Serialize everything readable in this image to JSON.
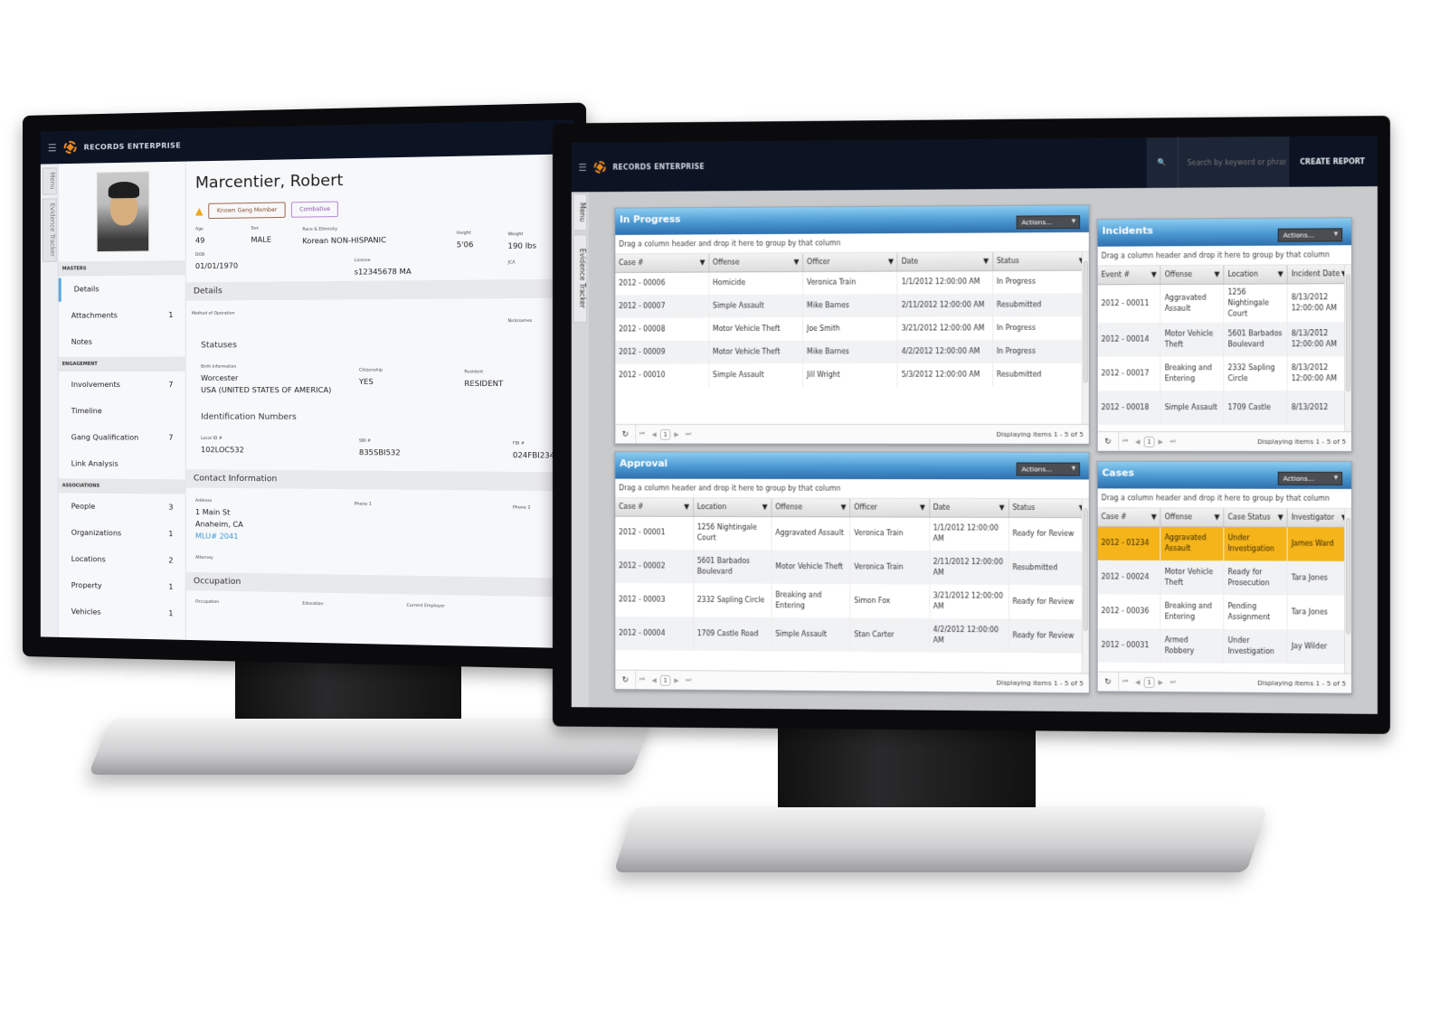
{
  "app": {
    "brand": "RECORDS ENTERPRISE",
    "menu_icon": "hamburger-icon",
    "logo_icon": "records-logo-icon"
  },
  "left_screen": {
    "side_tabs": [
      "Menu",
      "Evidence Tracker"
    ],
    "person": {
      "name": "Marcentier, Robert",
      "warning_icon": "warning-triangle-icon",
      "flags": [
        "Known Gang Member",
        "Combative"
      ],
      "summary": {
        "age": {
          "label": "Age",
          "value": "49"
        },
        "sex": {
          "label": "Sex",
          "value": "MALE"
        },
        "race": {
          "label": "Race & Ethnicity",
          "value": "Korean NON-HISPANIC"
        },
        "height": {
          "label": "Height",
          "value": "5'06"
        },
        "weight": {
          "label": "Weight",
          "value": "190 lbs"
        },
        "dob": {
          "label": "DOB",
          "value": "01/01/1970"
        },
        "license": {
          "label": "License",
          "value": "s12345678  MA"
        },
        "jca": {
          "label": "JCA",
          "value": ""
        }
      }
    },
    "nav": {
      "sections": [
        {
          "title": "MASTERS",
          "items": [
            {
              "label": "Details",
              "count": "",
              "active": true
            },
            {
              "label": "Attachments",
              "count": "1"
            },
            {
              "label": "Notes",
              "count": ""
            }
          ]
        },
        {
          "title": "ENGAGEMENT",
          "items": [
            {
              "label": "Involvements",
              "count": "7"
            },
            {
              "label": "Timeline",
              "count": ""
            },
            {
              "label": "Gang Qualification",
              "count": "7"
            },
            {
              "label": "Link Analysis",
              "count": ""
            }
          ]
        },
        {
          "title": "ASSOCIATIONS",
          "items": [
            {
              "label": "People",
              "count": "3"
            },
            {
              "label": "Organizations",
              "count": "1"
            },
            {
              "label": "Locations",
              "count": "2"
            },
            {
              "label": "Property",
              "count": "1"
            },
            {
              "label": "Vehicles",
              "count": "1"
            }
          ]
        }
      ]
    },
    "details": {
      "title": "Details",
      "method_label": "Method of Operation",
      "nicknames_label": "Nicknames",
      "statuses_title": "Statuses",
      "birth": {
        "label": "Birth Information",
        "line1": "Worcester",
        "line2": "USA (UNITED STATES OF AMERICA)"
      },
      "citizenship": {
        "label": "Citizenship",
        "value": "YES"
      },
      "resident": {
        "label": "Resident",
        "value": "RESIDENT"
      },
      "ids_title": "Identification Numbers",
      "local_id": {
        "label": "Local ID #",
        "value": "102LOC532"
      },
      "sbi": {
        "label": "SBI #",
        "value": "835SBI532"
      },
      "fbi": {
        "label": "FBI #",
        "value": "024FBI234"
      }
    },
    "contact": {
      "title": "Contact Information",
      "address_label": "Address",
      "address_line1": "1 Main St",
      "address_line2": "Anaheim, CA",
      "address_link": "MLU# 2041",
      "phone1_label": "Phone 1",
      "phone2_label": "Phone 2",
      "attorney_label": "Attorney"
    },
    "occupation": {
      "title": "Occupation",
      "occupation_label": "Occupation",
      "education_label": "Education",
      "employer_label": "Current Employer"
    }
  },
  "right_screen": {
    "side_tabs": [
      "Menu",
      "Evidence Tracker"
    ],
    "search_placeholder": "Search by keyword or phrase",
    "create_report": "CREATE REPORT",
    "group_hint": "Drag a column header and drop it here to group by that column",
    "actions_label": "Actions...",
    "panels": {
      "in_progress": {
        "title": "In Progress",
        "columns": [
          "Case #",
          "Offense",
          "Officer",
          "Date",
          "Status"
        ],
        "rows": [
          [
            "2012 - 00006",
            "Homicide",
            "Veronica Train",
            "1/1/2012 12:00:00 AM",
            "In Progress"
          ],
          [
            "2012 - 00007",
            "Simple Assault",
            "Mike Barnes",
            "2/11/2012 12:00:00 AM",
            "Resubmitted"
          ],
          [
            "2012 - 00008",
            "Motor Vehicle Theft",
            "Joe Smith",
            "3/21/2012 12:00:00 AM",
            "In Progress"
          ],
          [
            "2012 - 00009",
            "Motor Vehicle Theft",
            "Mike Barnes",
            "4/2/2012 12:00:00 AM",
            "In Progress"
          ],
          [
            "2012 - 00010",
            "Simple Assault",
            "Jill Wright",
            "5/3/2012 12:00:00 AM",
            "Resubmitted"
          ]
        ],
        "page": "1",
        "info": "Displaying items 1 - 5 of 5"
      },
      "incidents": {
        "title": "Incidents",
        "columns": [
          "Event #",
          "Offense",
          "Location",
          "Incident Date"
        ],
        "rows": [
          [
            "2012 - 00011",
            "Aggravated Assault",
            "1256 Nightingale Court",
            "8/13/2012 12:00:00 AM"
          ],
          [
            "2012 - 00014",
            "Motor Vehicle Theft",
            "5601 Barbados Boulevard",
            "8/13/2012 12:00:00 AM"
          ],
          [
            "2012 - 00017",
            "Breaking and Entering",
            "2332 Sapling Circle",
            "8/13/2012 12:00:00 AM"
          ],
          [
            "2012 - 00018",
            "Simple Assault",
            "1709 Castle",
            "8/13/2012"
          ]
        ],
        "page": "1",
        "info": "Displaying items 1 - 5 of 5"
      },
      "approval": {
        "title": "Approval",
        "columns": [
          "Case #",
          "Location",
          "Offense",
          "Officer",
          "Date",
          "Status"
        ],
        "rows": [
          [
            "2012 - 00001",
            "1256 Nightingale Court",
            "Aggravated Assault",
            "Veronica Train",
            "1/1/2012 12:00:00 AM",
            "Ready for Review"
          ],
          [
            "2012 - 00002",
            "5601 Barbados Boulevard",
            "Motor Vehicle Theft",
            "Veronica Train",
            "2/11/2012 12:00:00 AM",
            "Resubmitted"
          ],
          [
            "2012 - 00003",
            "2332 Sapling Circle",
            "Breaking and Entering",
            "Simon Fox",
            "3/21/2012 12:00:00 AM",
            "Ready for Review"
          ],
          [
            "2012 - 00004",
            "1709 Castle Road",
            "Simple Assault",
            "Stan Carter",
            "4/2/2012 12:00:00 AM",
            "Ready for Review"
          ]
        ],
        "page": "1",
        "info": "Displaying items 1 - 5 of 5"
      },
      "cases": {
        "title": "Cases",
        "columns": [
          "Case #",
          "Offense",
          "Case Status",
          "Investigator"
        ],
        "rows": [
          [
            "2012 - 01234",
            "Aggravated Assault",
            "Under Investigation",
            "James Ward"
          ],
          [
            "2012 - 00024",
            "Motor Vehicle Theft",
            "Ready for Prosecution",
            "Tara Jones"
          ],
          [
            "2012 - 00036",
            "Breaking and Entering",
            "Pending Assignment",
            "Tara Jones"
          ],
          [
            "2012 - 00031",
            "Armed Robbery",
            "Under Investigation",
            "Jay Wilder"
          ]
        ],
        "highlight_row": 0,
        "highlight_color": "#f4b41a",
        "page": "1",
        "info": "Displaying items 1 - 5 of 5"
      }
    }
  },
  "colors": {
    "header_bg": "#0c1424",
    "panel_header_blue": "#4a98d2",
    "accent_orange": "#f08a1c",
    "active_nav": "#5aa7d9",
    "link": "#3a9ad9"
  }
}
